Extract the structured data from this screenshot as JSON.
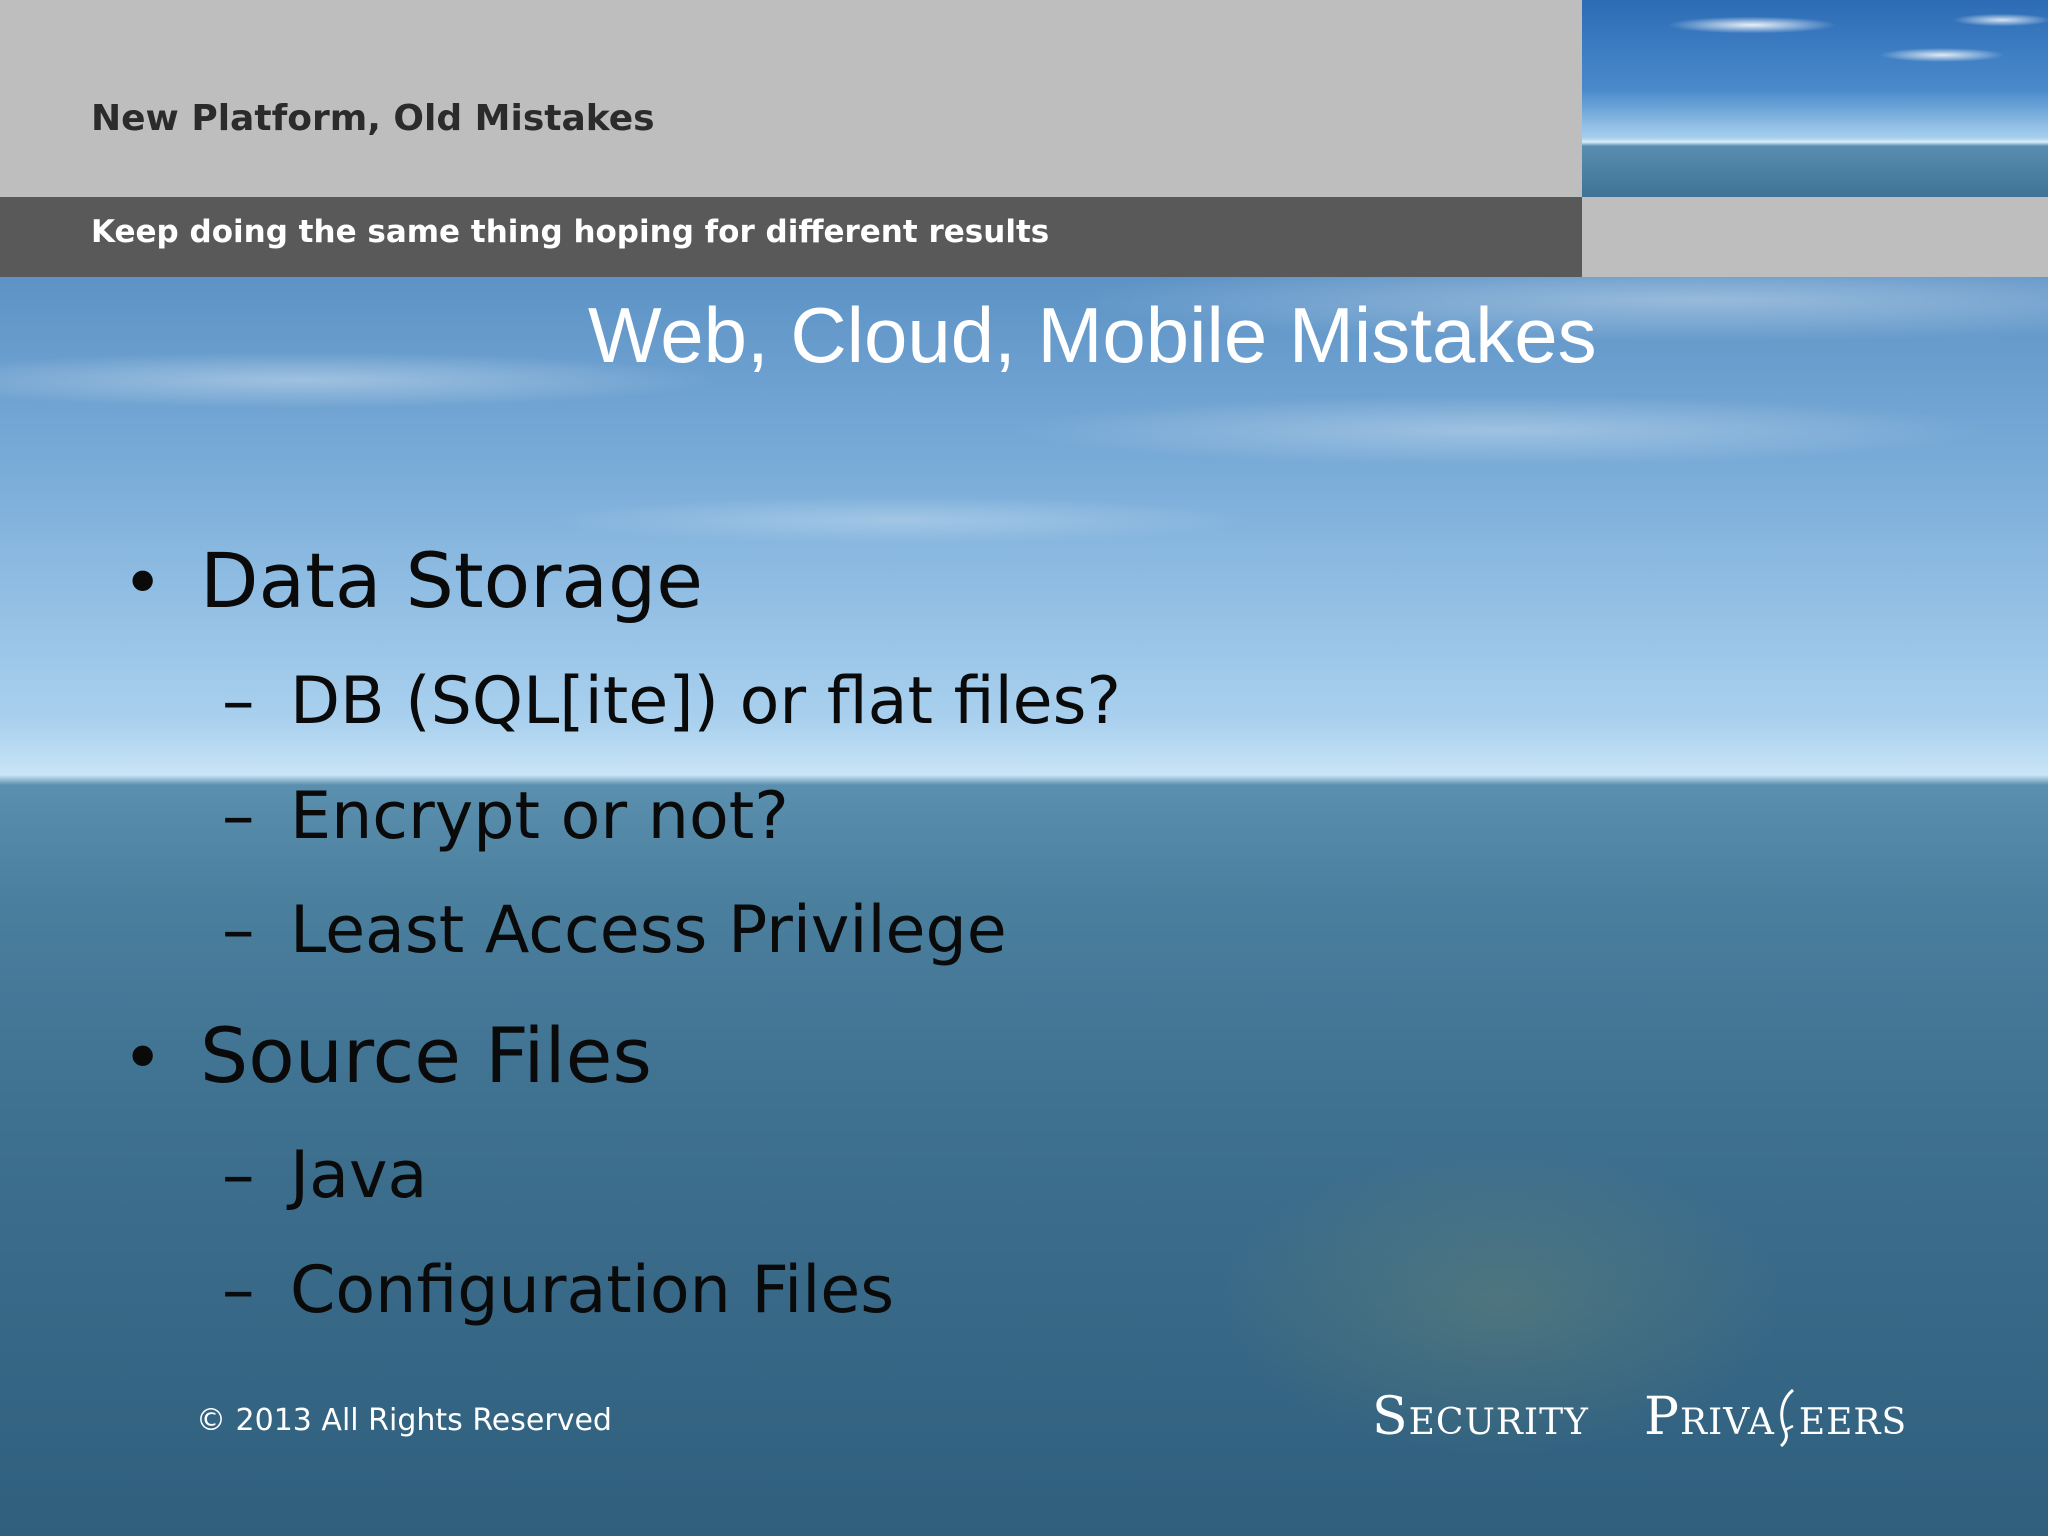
{
  "header": {
    "title": "New Platform, Old Mistakes",
    "subtitle": "Keep doing the same thing hoping for different results"
  },
  "slide": {
    "title": "Web, Cloud, Mobile Mistakes",
    "bullets": [
      {
        "text": "Data Storage",
        "subitems": [
          "DB (SQL[ite]) or flat files?",
          "Encrypt or not?",
          "Least Access Privilege"
        ]
      },
      {
        "text": "Source Files",
        "subitems": [
          "Java",
          "Configuration Files"
        ]
      }
    ]
  },
  "footer": {
    "copyright": "© 2013 All Rights Reserved",
    "logo_word1": "Security",
    "logo_word2_part1": "Priva",
    "logo_word2_part2": "eers"
  },
  "colors": {
    "header_gray": "#bebebe",
    "header_band": "#595959",
    "title_white": "#ffffff",
    "bullet_text": "#0a0a0a"
  }
}
